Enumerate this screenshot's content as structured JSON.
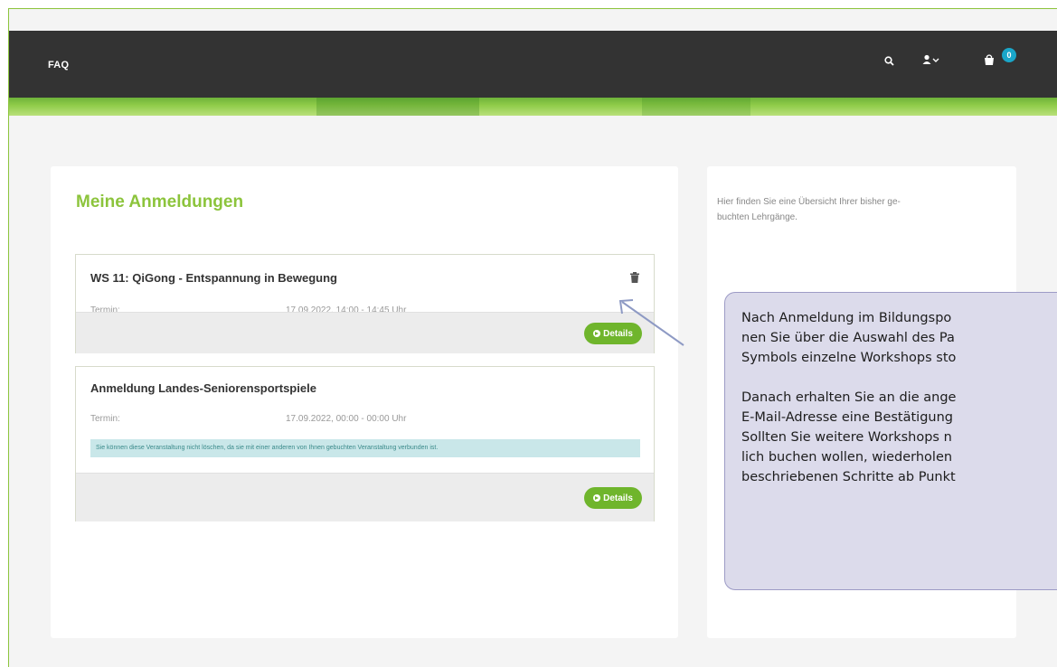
{
  "header": {
    "faq_label": "FAQ",
    "cart_count": "0",
    "icons": [
      "search-icon",
      "user-icon",
      "cart-icon"
    ]
  },
  "main": {
    "title": "Meine Anmeldungen",
    "registrations": [
      {
        "title": "WS 11: QiGong - Entspannung in Bewegung",
        "term_label": "Termin:",
        "date": "17.09.2022, 14:00 - 14:45 Uhr",
        "details_label": "Details"
      },
      {
        "title": "Anmeldung Landes-Seniorensportspiele",
        "term_label": "Termin:",
        "date": "17.09.2022, 00:00 - 00:00 Uhr",
        "notice": "Sie können diese Veranstaltung nicht löschen, da sie mit einer anderen von Ihnen gebuchten Veranstaltung verbunden ist.",
        "details_label": "Details"
      }
    ]
  },
  "sidebar": {
    "text": "Hier finden Sie eine Übersicht Ihrer bisher ge-\nbuchten Lehrgänge."
  },
  "callout": {
    "text": "Nach Anmeldung im Bildungspo\nnen Sie über die Auswahl des Pa\nSymbols einzelne Workshops sto\n\nDanach erhalten Sie an die ange\nE-Mail-Adresse eine Bestätigung\nSollten Sie weitere Workshops n\nlich buchen wollen, wiederholen\nbeschriebenen Schritte ab Punkt"
  },
  "colors": {
    "accent": "#8cc43c",
    "button": "#6fb52c",
    "topbar": "#333333",
    "badge": "#1aa6c9",
    "callout_bg": "#dcdbeb"
  }
}
